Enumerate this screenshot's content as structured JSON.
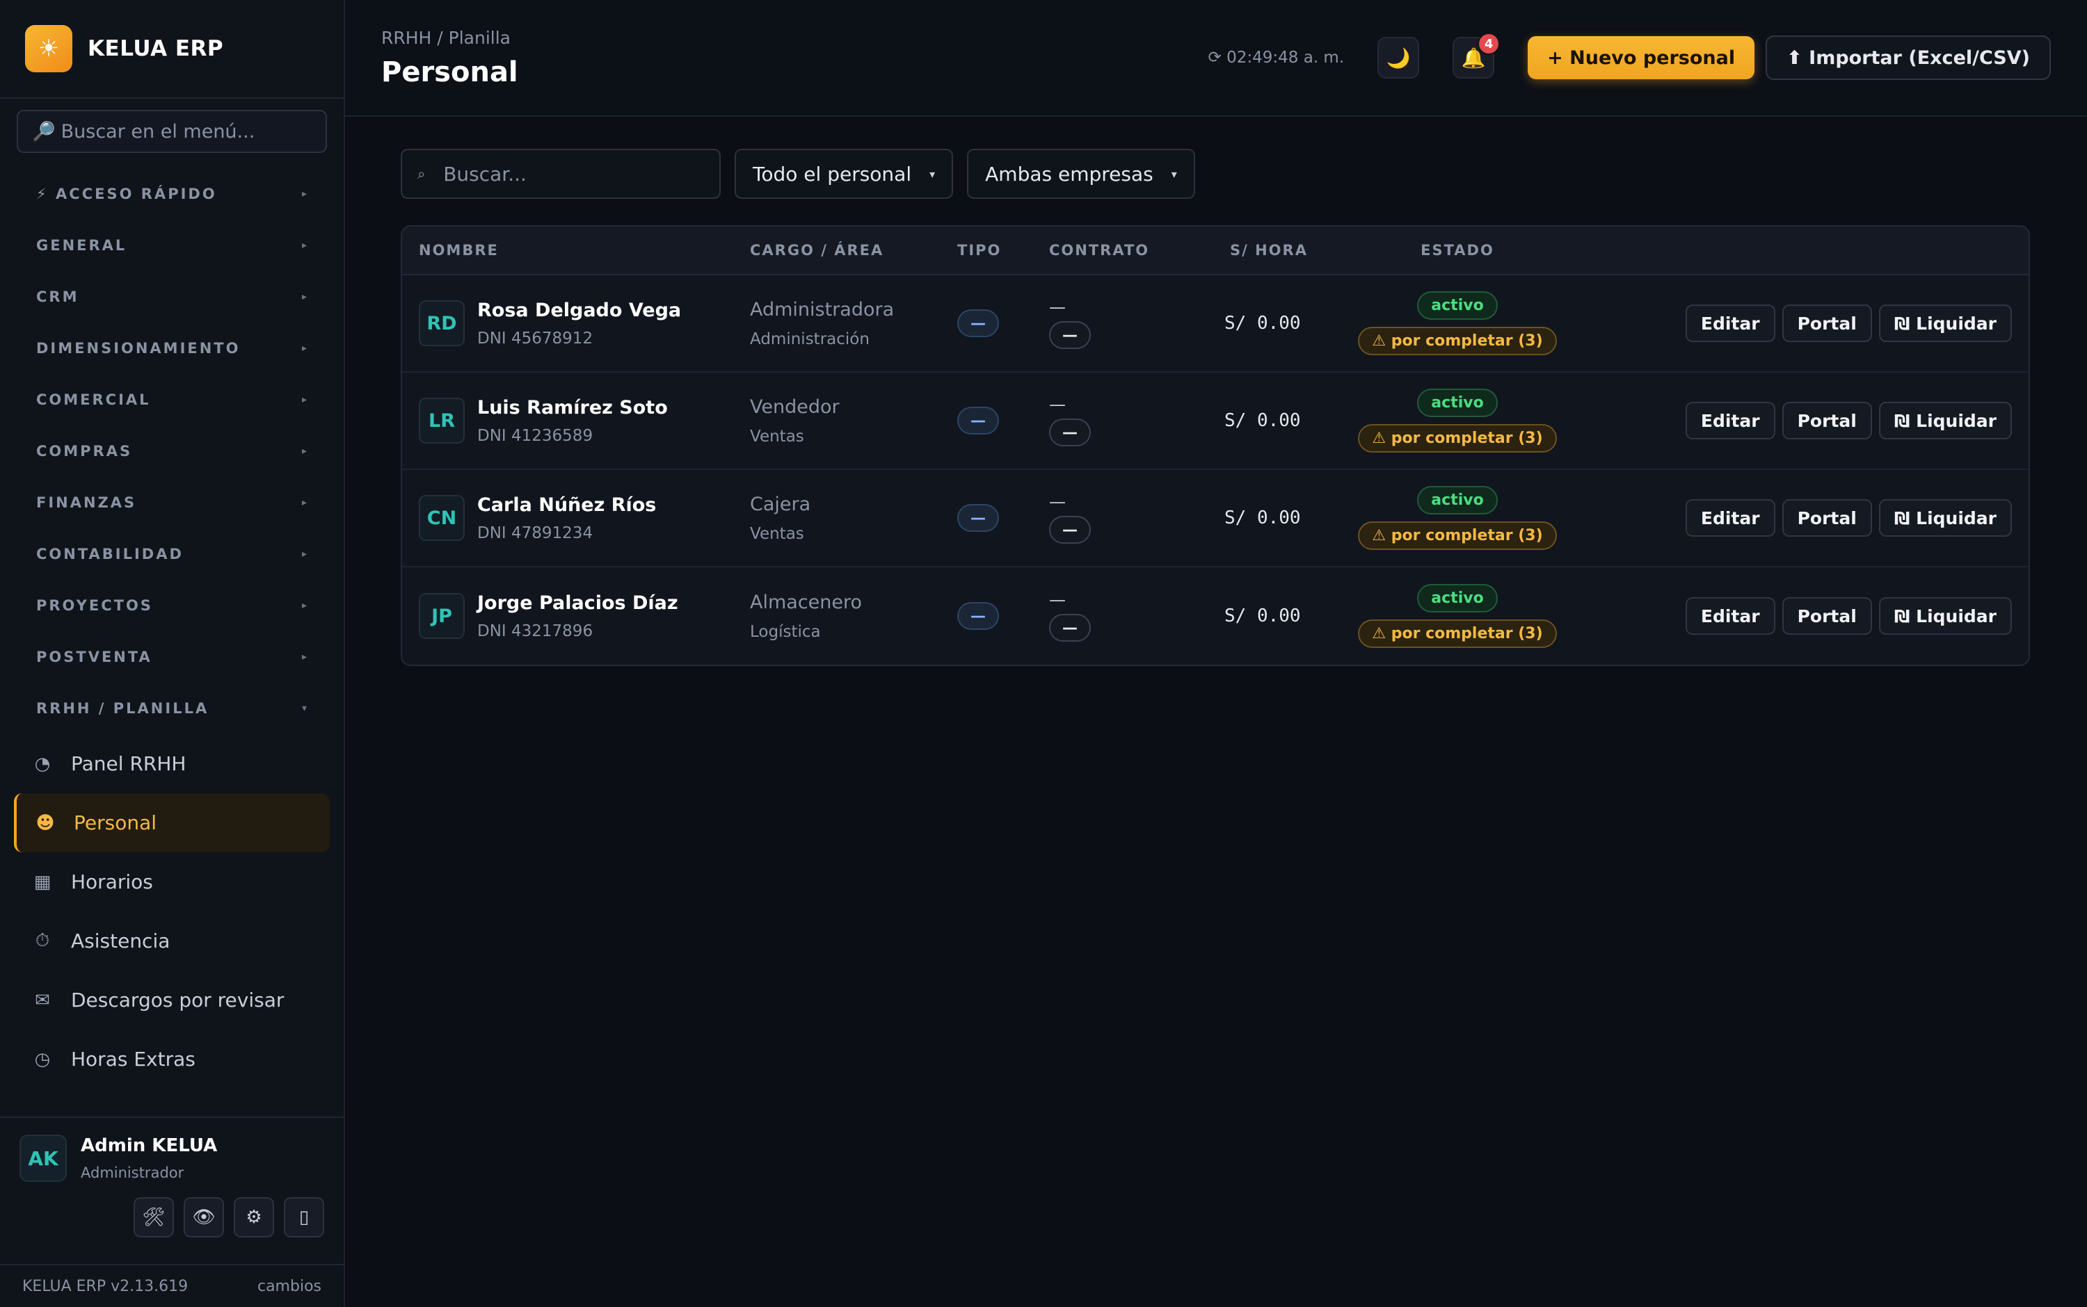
{
  "brand": {
    "name": "KELUA ERP",
    "logo_icon": "☀"
  },
  "sidebar": {
    "search_placeholder": "Buscar en el menú...",
    "sections": [
      {
        "label": "⚡ ACCESO RÁPIDO",
        "chevron": "▸"
      },
      {
        "label": "GENERAL",
        "chevron": "▸"
      },
      {
        "label": "CRM",
        "chevron": "▸"
      },
      {
        "label": "DIMENSIONAMIENTO",
        "chevron": "▸"
      },
      {
        "label": "COMERCIAL",
        "chevron": "▸"
      },
      {
        "label": "COMPRAS",
        "chevron": "▸"
      },
      {
        "label": "FINANZAS",
        "chevron": "▸"
      },
      {
        "label": "CONTABILIDAD",
        "chevron": "▸"
      },
      {
        "label": "PROYECTOS",
        "chevron": "▸"
      },
      {
        "label": "POSTVENTA",
        "chevron": "▸"
      },
      {
        "label": "RRHH / PLANILLA",
        "chevron": "▾"
      }
    ],
    "rrhh_items": [
      {
        "label": "Panel RRHH",
        "icon": "◔"
      },
      {
        "label": "Personal",
        "icon": "☻"
      },
      {
        "label": "Horarios",
        "icon": "▦"
      },
      {
        "label": "Asistencia",
        "icon": "⏱"
      },
      {
        "label": "Descargos por revisar",
        "icon": "✉"
      },
      {
        "label": "Horas Extras",
        "icon": "◷"
      }
    ],
    "user": {
      "initials": "AK",
      "name": "Admin KELUA",
      "role": "Administrador"
    },
    "tools": [
      "🛠",
      "👁",
      "⚙",
      "▯"
    ],
    "footer": {
      "version": "KELUA ERP v2.13.619",
      "changes": "cambios"
    }
  },
  "header": {
    "breadcrumb": "RRHH / Planilla",
    "title": "Personal",
    "clock": "⟳ 02:49:48 a. m.",
    "theme_icon": "🌙",
    "bell_icon": "🔔",
    "notifications": "4",
    "new_button": "+ Nuevo personal",
    "import_button": "⬆ Importar (Excel/CSV)"
  },
  "filters": {
    "search_placeholder": "Buscar...",
    "search_icon": "⌕",
    "staff_select": "Todo el personal",
    "company_select": "Ambas empresas",
    "caret": "▾"
  },
  "table": {
    "columns": {
      "name": "NOMBRE",
      "cargo": "CARGO / ÁREA",
      "tipo": "TIPO",
      "contrato": "CONTRATO",
      "hora": "S/ HORA",
      "estado": "ESTADO"
    },
    "rows": [
      {
        "initials": "RD",
        "name": "Rosa Delgado Vega",
        "dni": "DNI 45678912",
        "cargo": "Administradora",
        "area": "Administración",
        "tipo": "—",
        "contrato_dash": "—",
        "contrato_pill": "—",
        "hora": "S/ 0.00",
        "status": "activo",
        "warning": "⚠ por completar (3)"
      },
      {
        "initials": "LR",
        "name": "Luis Ramírez Soto",
        "dni": "DNI 41236589",
        "cargo": "Vendedor",
        "area": "Ventas",
        "tipo": "—",
        "contrato_dash": "—",
        "contrato_pill": "—",
        "hora": "S/ 0.00",
        "status": "activo",
        "warning": "⚠ por completar (3)"
      },
      {
        "initials": "CN",
        "name": "Carla Núñez Ríos",
        "dni": "DNI 47891234",
        "cargo": "Cajera",
        "area": "Ventas",
        "tipo": "—",
        "contrato_dash": "—",
        "contrato_pill": "—",
        "hora": "S/ 0.00",
        "status": "activo",
        "warning": "⚠ por completar (3)"
      },
      {
        "initials": "JP",
        "name": "Jorge Palacios Díaz",
        "dni": "DNI 43217896",
        "cargo": "Almacenero",
        "area": "Logística",
        "tipo": "—",
        "contrato_dash": "—",
        "contrato_pill": "—",
        "hora": "S/ 0.00",
        "status": "activo",
        "warning": "⚠ por completar (3)"
      }
    ],
    "actions": {
      "edit": "Editar",
      "portal": "Portal",
      "liquidate": "₪ Liquidar"
    }
  },
  "colors": {
    "accent": "#f5a623",
    "background": "#0b0e14",
    "active_green": "#4ade80",
    "warning_amber": "#f5b942",
    "avatar_teal": "#2ec4b6"
  }
}
